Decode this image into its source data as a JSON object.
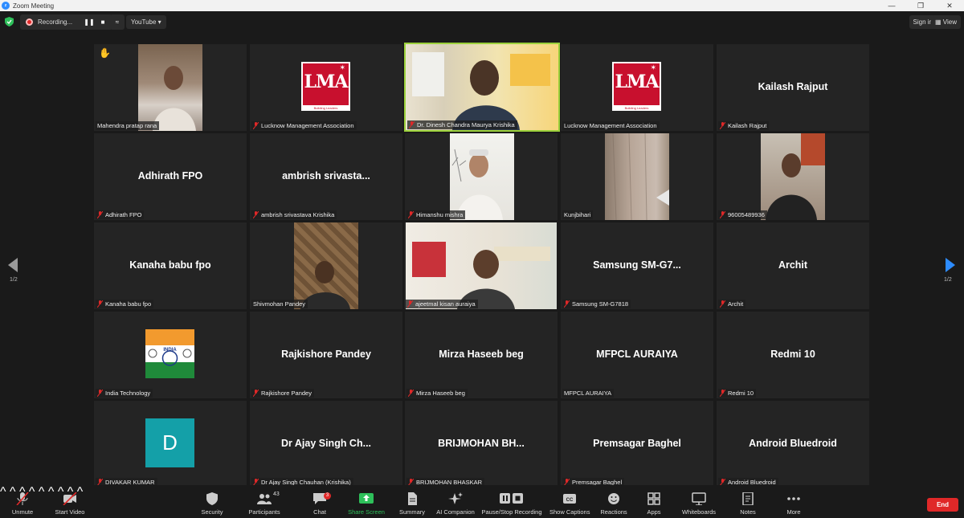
{
  "window": {
    "title": "Zoom Meeting"
  },
  "topbar": {
    "recording_label": "Recording...",
    "stream_label": "YouTube",
    "signin_label": "Sign in",
    "view_label": "View"
  },
  "tiles": [
    {
      "big": "",
      "name": "Mahendra pratap rana"
    },
    {
      "big": "",
      "name": "Lucknow Management Association"
    },
    {
      "big": "",
      "name": "Dr. Dinesh Chandra Maurya Krishika"
    },
    {
      "big": "",
      "name": "Lucknow Management Association"
    },
    {
      "big": "Kailash Rajput",
      "name": "Kailash Rajput"
    },
    {
      "big": "Adhirath FPO",
      "name": "Adhirath FPO"
    },
    {
      "big": "ambrish srivasta...",
      "name": "ambrish srivastava Krishika"
    },
    {
      "big": "",
      "name": "Himanshu mishra"
    },
    {
      "big": "",
      "name": "Kunjbihari"
    },
    {
      "big": "",
      "name": "96005489936"
    },
    {
      "big": "Kanaha babu fpo",
      "name": "Kanaha babu fpo"
    },
    {
      "big": "",
      "name": "Shivmohan Pandey"
    },
    {
      "big": "",
      "name": "ajeetmal kisan auraiya"
    },
    {
      "big": "Samsung SM-G7...",
      "name": "Samsung SM-G7818"
    },
    {
      "big": "Archit",
      "name": "Archit"
    },
    {
      "big": "",
      "name": "India Technology"
    },
    {
      "big": "Rajkishore Pandey",
      "name": "Rajkishore Pandey"
    },
    {
      "big": "Mirza Haseeb beg",
      "name": "Mirza Haseeb beg"
    },
    {
      "big": "MFPCL AURAIYA",
      "name": "MFPCL AURAIYA"
    },
    {
      "big": "Redmi 10",
      "name": "Redmi 10"
    },
    {
      "big": "",
      "name": "DIVAKAR KUMAR"
    },
    {
      "big": "Dr Ajay Singh Ch...",
      "name": "Dr Ajay Singh Chauhan (Krishika)"
    },
    {
      "big": "BRIJMOHAN BH...",
      "name": "BRIJMOHAN BHASKAR"
    },
    {
      "big": "Premsagar Baghel",
      "name": "Premsagar Baghel"
    },
    {
      "big": "Android Bluedroid",
      "name": "Android Bluedroid"
    }
  ],
  "logos": {
    "lma_text": "LMA",
    "lma_sub": "Building Leaders",
    "divakar_initial": "D",
    "india_text": "INDIA"
  },
  "pager": {
    "left": "1/2",
    "right": "1/2"
  },
  "toolbar": {
    "unmute": "Unmute",
    "start_video": "Start Video",
    "security": "Security",
    "participants": "Participants",
    "participants_count": "43",
    "chat": "Chat",
    "chat_badge": "3",
    "share_screen": "Share Screen",
    "summary": "Summary",
    "ai_companion": "AI Companion",
    "pause_recording": "Pause/Stop Recording",
    "show_captions": "Show Captions",
    "reactions": "Reactions",
    "apps": "Apps",
    "whiteboards": "Whiteboards",
    "notes": "Notes",
    "more": "More",
    "end": "End"
  },
  "colors": {
    "accent": "#2d8cff",
    "active_speaker": "#9bd03b",
    "end_red": "#e02828",
    "share_green": "#2ec05a"
  }
}
